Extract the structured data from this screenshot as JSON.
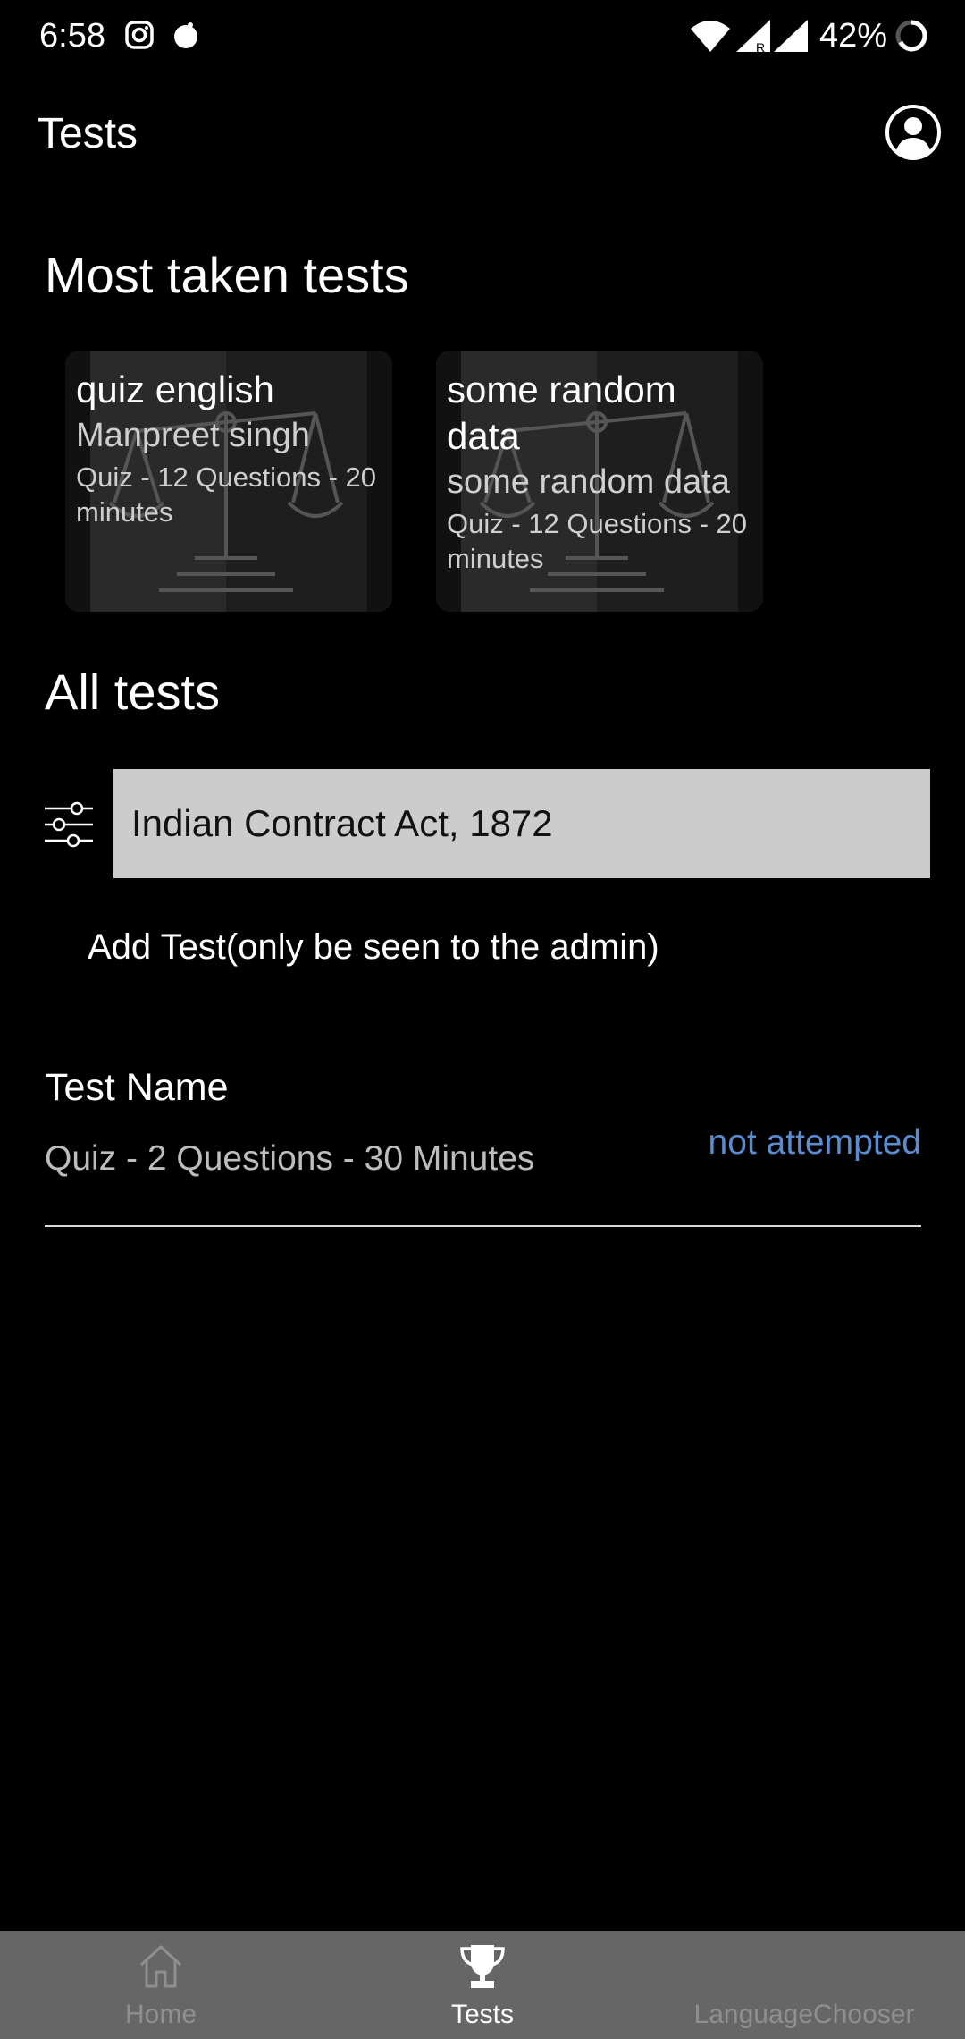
{
  "status_bar": {
    "time": "6:58",
    "battery": "42%",
    "network_badge": "R",
    "icons": [
      "instagram-icon",
      "notification-dot-icon",
      "wifi-icon",
      "cell-signal-icon",
      "battery-ring-icon"
    ]
  },
  "app_bar": {
    "title": "Tests",
    "account_icon": "account-circle-icon"
  },
  "most_taken": {
    "title": "Most taken tests",
    "cards": [
      {
        "title": "quiz english",
        "author": "Manpreet singh",
        "meta": "Quiz - 12 Questions - 20 minutes",
        "image_icon": "scales-of-justice-icon"
      },
      {
        "title": "some random data",
        "author": "some random data",
        "meta": "Quiz - 12 Questions - 20 minutes",
        "image_icon": "scales-of-justice-icon"
      }
    ]
  },
  "all_tests": {
    "title": "All tests",
    "filter_icon": "filter-sliders-icon",
    "search_value": "Indian Contract Act, 1872",
    "add_test_label": "Add Test(only be seen to the admin)",
    "items": [
      {
        "name": "Test Name",
        "meta": "Quiz - 2 Questions - 30 Minutes",
        "status": "not attempted"
      }
    ]
  },
  "bottom_nav": {
    "items": [
      {
        "label": "Home",
        "icon": "home-icon",
        "active": false
      },
      {
        "label": "Tests",
        "icon": "trophy-icon",
        "active": true
      },
      {
        "label": "LanguageChooser",
        "icon": "",
        "active": false
      }
    ]
  },
  "colors": {
    "background": "#000000",
    "search_bg": "#cccccc",
    "status_link": "#5b8ccf",
    "nav_bg": "#666666",
    "nav_inactive": "#8f8f8f",
    "nav_active": "#ffffff"
  }
}
